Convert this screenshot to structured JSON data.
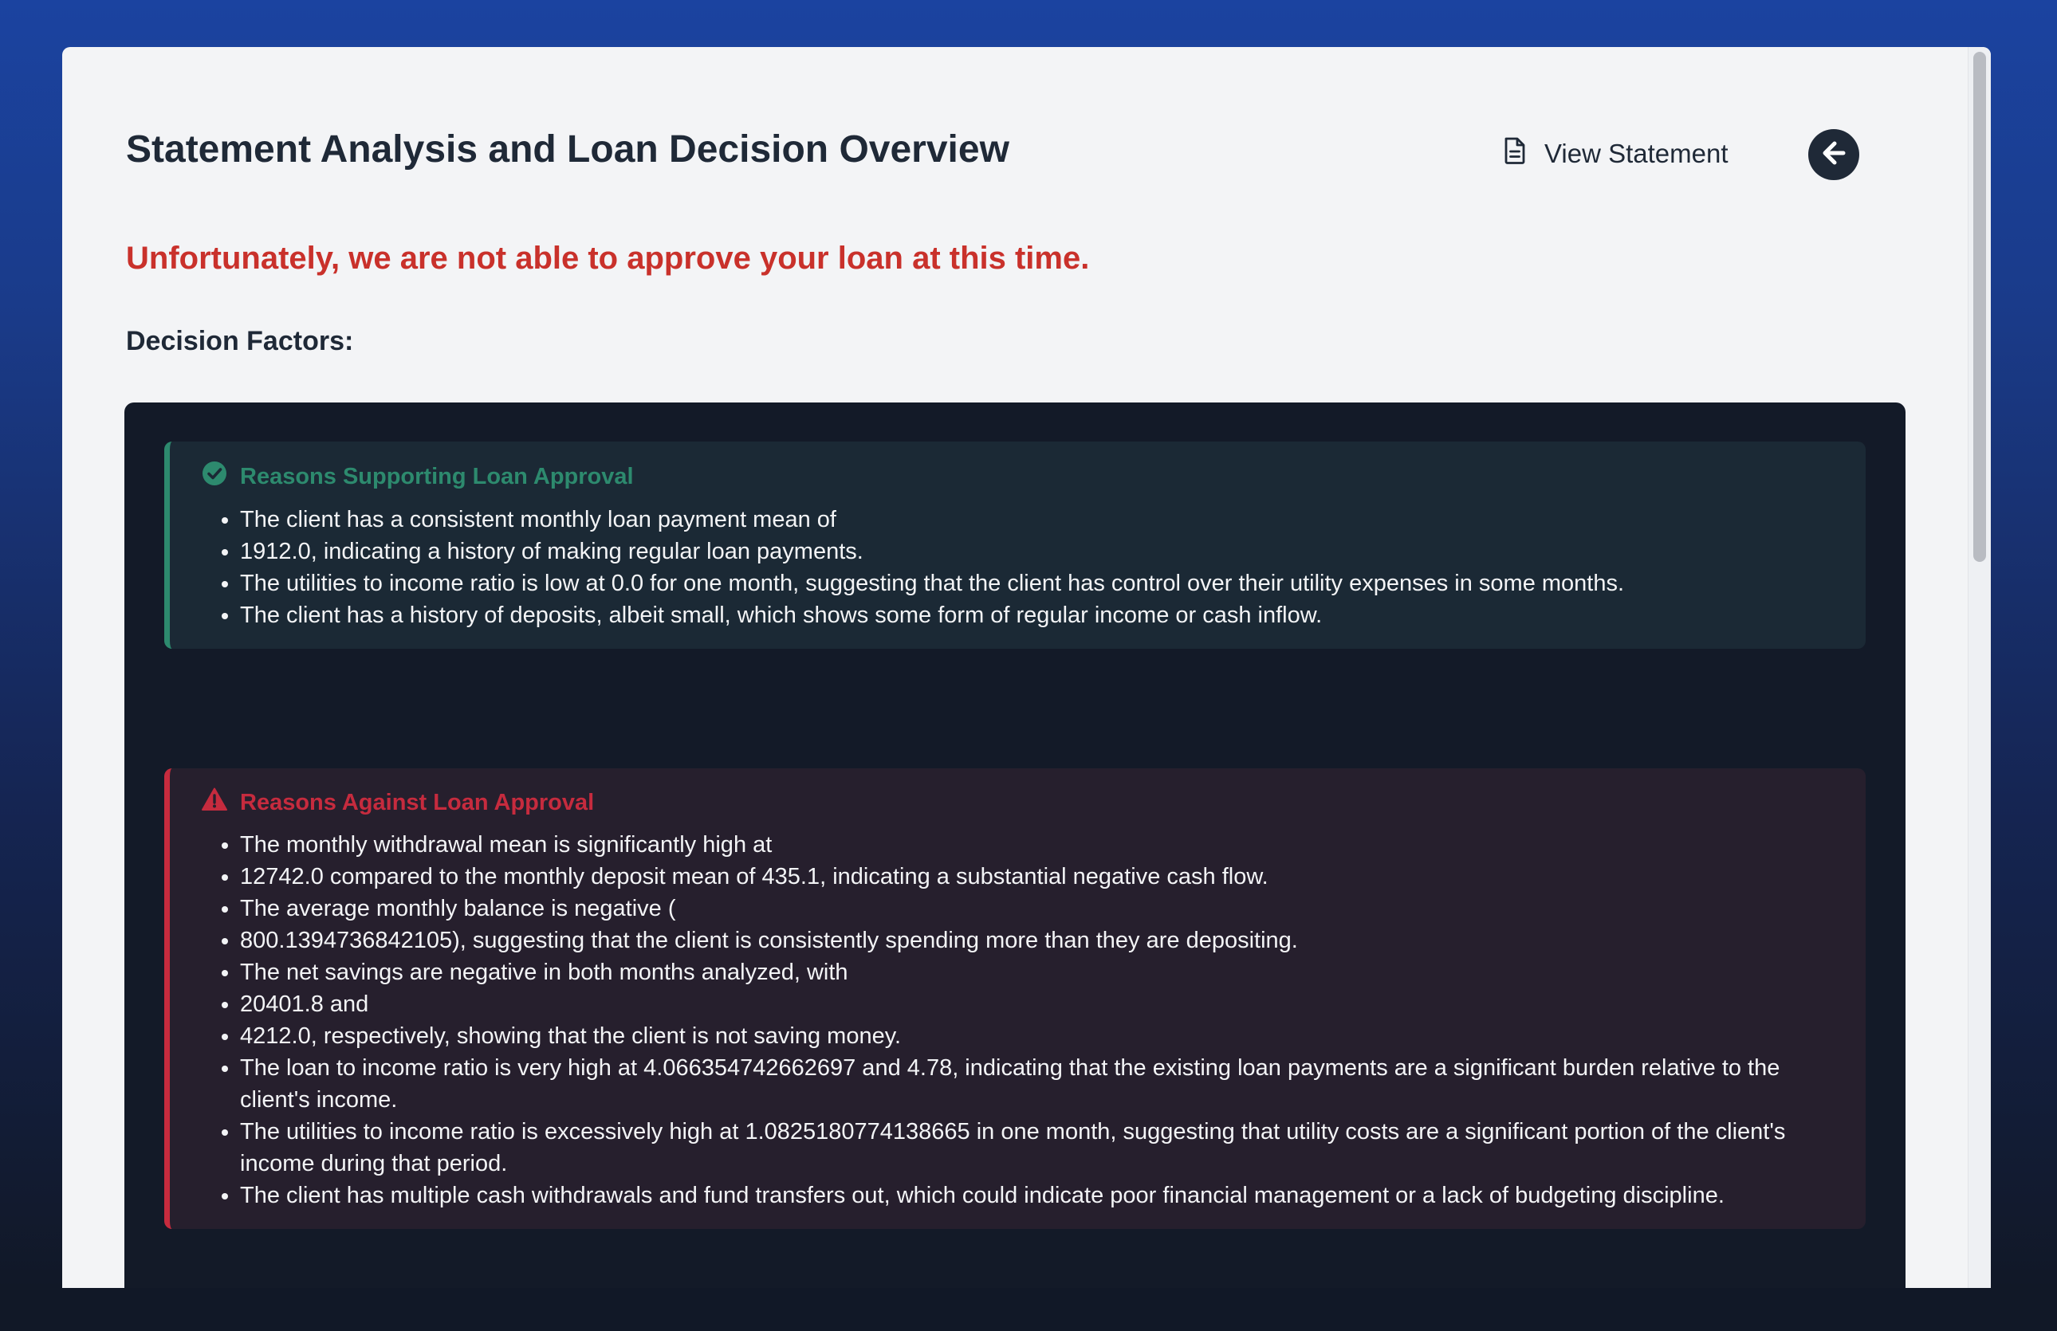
{
  "header": {
    "title": "Statement Analysis and Loan Decision Overview",
    "view_statement_label": "View Statement"
  },
  "decision": {
    "message": "Unfortunately, we are not able to approve your loan at this time."
  },
  "factors": {
    "heading": "Decision Factors:",
    "supporting": {
      "title": "Reasons Supporting Loan Approval",
      "items": [
        "The client has a consistent monthly loan payment mean of",
        "1912.0, indicating a history of making regular loan payments.",
        "The utilities to income ratio is low at 0.0 for one month, suggesting that the client has control over their utility expenses in some months.",
        "The client has a history of deposits, albeit small, which shows some form of regular income or cash inflow."
      ]
    },
    "against": {
      "title": "Reasons Against Loan Approval",
      "items": [
        "The monthly withdrawal mean is significantly high at",
        "12742.0 compared to the monthly deposit mean of 435.1, indicating a substantial negative cash flow.",
        "The average monthly balance is negative (",
        "800.1394736842105), suggesting that the client is consistently spending more than they are depositing.",
        "The net savings are negative in both months analyzed, with",
        "20401.8 and",
        "4212.0, respectively, showing that the client is not saving money.",
        "The loan to income ratio is very high at 4.066354742662697 and 4.78, indicating that the existing loan payments are a significant burden relative to the client's income.",
        "The utilities to income ratio is excessively high at 1.0825180774138665 in one month, suggesting that utility costs are a significant portion of the client's income during that period.",
        "The client has multiple cash withdrawals and fund transfers out, which could indicate poor financial management or a lack of budgeting discipline."
      ]
    }
  },
  "icons": {
    "view_statement": "document-icon",
    "back": "arrow-left-icon",
    "supporting": "check-circle-icon",
    "against": "warning-triangle-icon"
  },
  "colors": {
    "approval_green": "#2d8a6e",
    "rejection_red": "#c62b3e",
    "decision_red": "#c9312b"
  }
}
